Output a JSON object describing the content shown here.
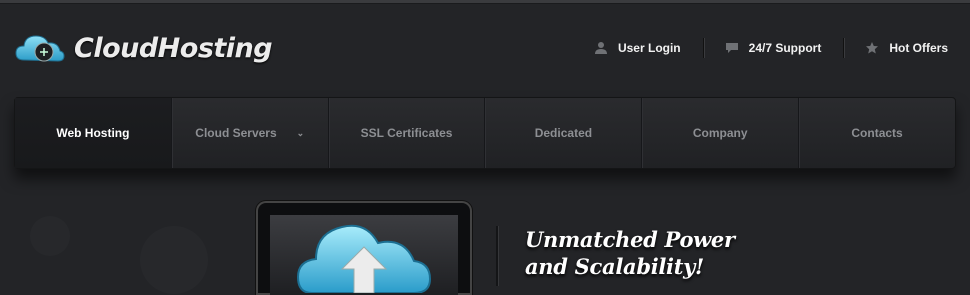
{
  "brand": {
    "name": "CloudHosting",
    "accent": "#4fc3e8"
  },
  "toplinks": [
    {
      "label": "User Login",
      "icon": "user-icon"
    },
    {
      "label": "24/7 Support",
      "icon": "chat-icon"
    },
    {
      "label": "Hot Offers",
      "icon": "star-icon"
    }
  ],
  "nav": {
    "items": [
      {
        "label": "Web Hosting",
        "active": true
      },
      {
        "label": "Cloud Servers",
        "has_dropdown": true
      },
      {
        "label": "SSL Certificates"
      },
      {
        "label": "Dedicated"
      },
      {
        "label": "Company"
      },
      {
        "label": "Contacts"
      }
    ]
  },
  "hero": {
    "title_line1": "Unmatched Power",
    "title_line2": "and Scalability!",
    "image_icon": "cloud-upload-icon"
  }
}
